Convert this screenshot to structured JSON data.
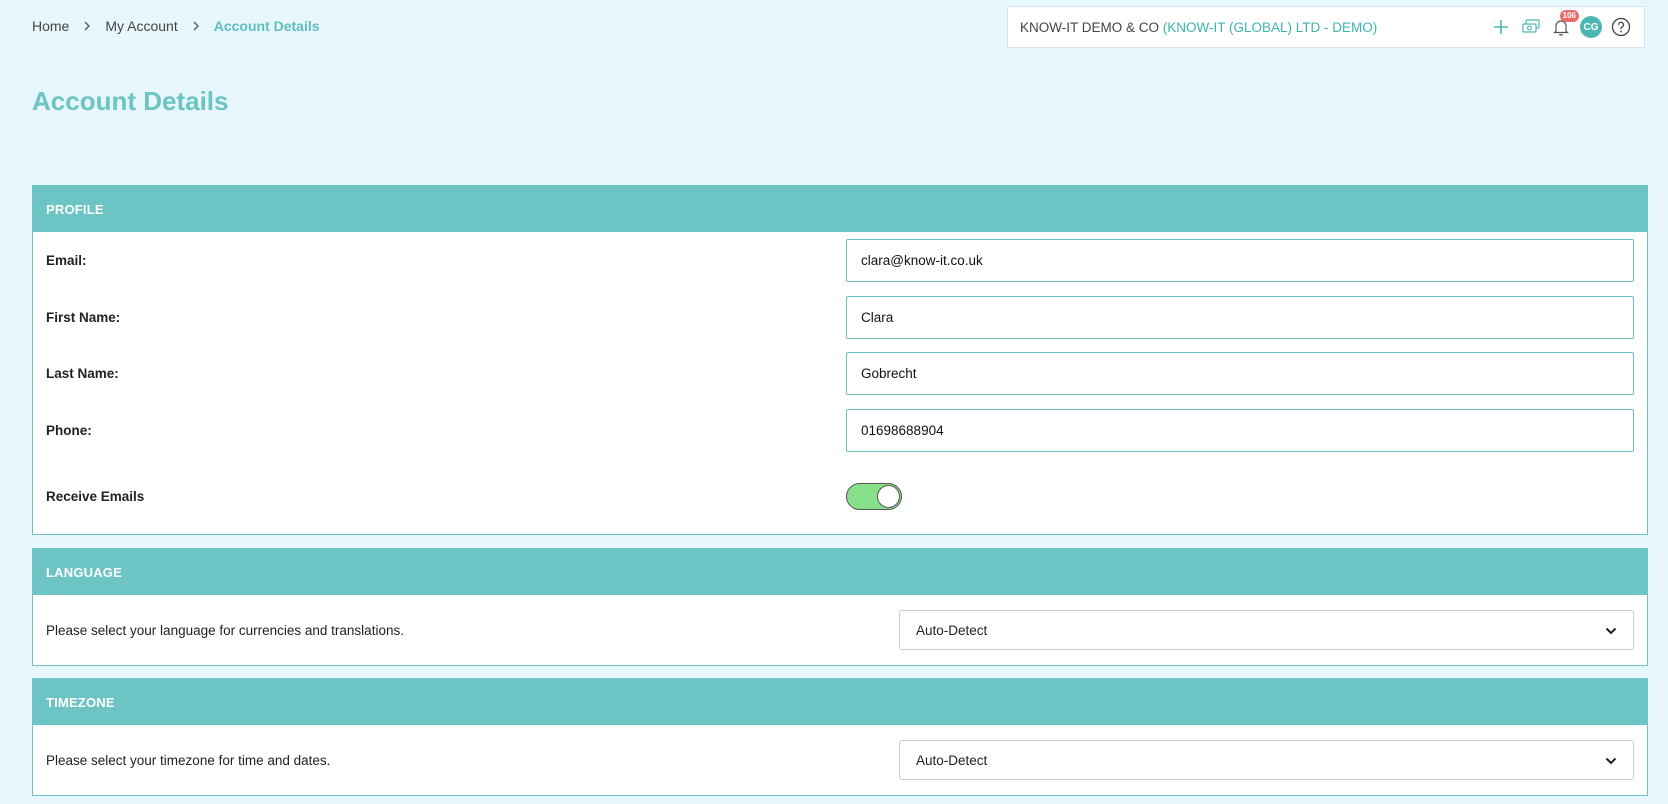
{
  "breadcrumb": {
    "items": [
      "Home",
      "My Account"
    ],
    "current": "Account Details"
  },
  "company": {
    "name": "KNOW-IT DEMO & CO",
    "org": "(KNOW-IT (GLOBAL) LTD - DEMO)"
  },
  "header_icons": {
    "add": "plus-icon",
    "money": "money-icon",
    "notifications": "bell-icon",
    "notification_count": "106",
    "avatar_initials": "CG",
    "help": "help-icon"
  },
  "page_title": "Account Details",
  "profile": {
    "header": "PROFILE",
    "email_label": "Email:",
    "email_value": "clara@know-it.co.uk",
    "first_name_label": "First Name:",
    "first_name_value": "Clara",
    "last_name_label": "Last Name:",
    "last_name_value": "Gobrecht",
    "phone_label": "Phone:",
    "phone_value": "01698688904",
    "receive_emails_label": "Receive Emails",
    "receive_emails_on": true
  },
  "language": {
    "header": "LANGUAGE",
    "description": "Please select your language for currencies and translations.",
    "selected": "Auto-Detect"
  },
  "timezone": {
    "header": "TIMEZONE",
    "description": "Please select your timezone for time and dates.",
    "selected": "Auto-Detect"
  },
  "colors": {
    "accent": "#6cc4c4",
    "background": "#e8f6fd",
    "toggle_on": "#88e08a",
    "badge": "#e86b6b"
  }
}
